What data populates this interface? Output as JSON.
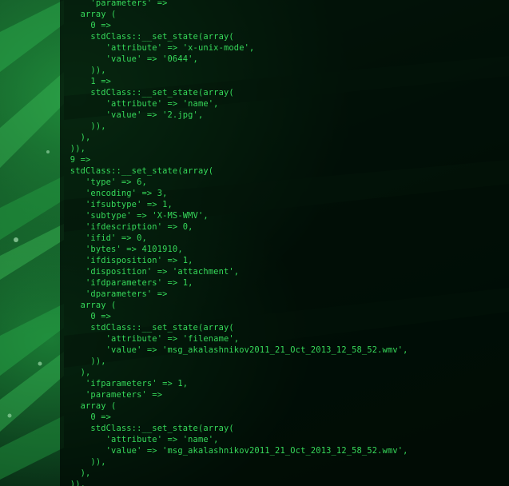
{
  "terminal": {
    "lines": [
      "      'parameters' =>",
      "    array (",
      "      0 =>",
      "      stdClass::__set_state(array(",
      "         'attribute' => 'x-unix-mode',",
      "         'value' => '0644',",
      "      )),",
      "      1 =>",
      "      stdClass::__set_state(array(",
      "         'attribute' => 'name',",
      "         'value' => '2.jpg',",
      "      )),",
      "    ),",
      "  )),",
      "  9 =>",
      "  stdClass::__set_state(array(",
      "     'type' => 6,",
      "     'encoding' => 3,",
      "     'ifsubtype' => 1,",
      "     'subtype' => 'X-MS-WMV',",
      "     'ifdescription' => 0,",
      "     'ifid' => 0,",
      "     'bytes' => 4101910,",
      "     'ifdisposition' => 1,",
      "     'disposition' => 'attachment',",
      "     'ifdparameters' => 1,",
      "     'dparameters' =>",
      "    array (",
      "      0 =>",
      "      stdClass::__set_state(array(",
      "         'attribute' => 'filename',",
      "         'value' => 'msg_akalashnikov2011_21_Oct_2013_12_58_52.wmv',",
      "      )),",
      "    ),",
      "     'ifparameters' => 1,",
      "     'parameters' =>",
      "    array (",
      "      0 =>",
      "      stdClass::__set_state(array(",
      "         'attribute' => 'name',",
      "         'value' => 'msg_akalashnikov2011_21_Oct_2013_12_58_52.wmv',",
      "      )),",
      "    ),",
      "  )),"
    ]
  }
}
